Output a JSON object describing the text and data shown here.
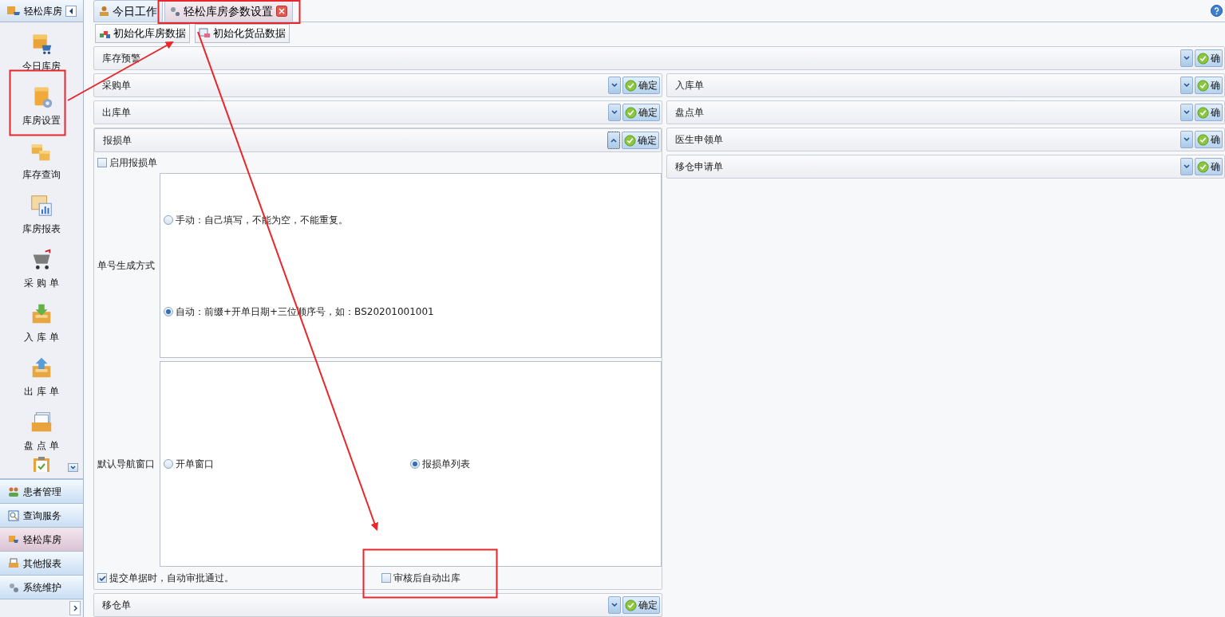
{
  "sidebar": {
    "title": "轻松库房",
    "items": [
      {
        "label": "今日库房"
      },
      {
        "label": "库房设置"
      },
      {
        "label": "库存查询"
      },
      {
        "label": "库房报表"
      },
      {
        "label": "采 购 单"
      },
      {
        "label": "入 库 单"
      },
      {
        "label": "出 库 单"
      },
      {
        "label": "盘 点 单"
      }
    ],
    "groups": [
      {
        "label": "患者管理",
        "selected": false
      },
      {
        "label": "查询服务",
        "selected": false
      },
      {
        "label": "轻松库房",
        "selected": true
      },
      {
        "label": "其他报表",
        "selected": false
      },
      {
        "label": "系统维护",
        "selected": false
      }
    ]
  },
  "tabs": [
    {
      "label": "今日工作",
      "selected": false,
      "closable": false
    },
    {
      "label": "轻松库房参数设置",
      "selected": true,
      "closable": true
    }
  ],
  "toolbar": [
    "初始化库房数据",
    "初始化货品数据"
  ],
  "top_panel": {
    "title": "库存预警",
    "expanded": false,
    "confirm": "确"
  },
  "left_panels": [
    {
      "title": "采购单",
      "expanded": false,
      "confirm": "确定"
    },
    {
      "title": "出库单",
      "expanded": false,
      "confirm": "确定"
    },
    {
      "title": "报损单",
      "expanded": true,
      "confirm": "确定",
      "body": {
        "enable": {
          "label": "启用报损单",
          "checked": false
        },
        "rows": [
          {
            "label": "单号生成方式",
            "kind": "stacked",
            "options": [
              {
                "label": "手动：自己填写，不能为空，不能重复。",
                "selected": false
              },
              {
                "label": "自动：前缀+开单日期+三位顺序号，如：BS20201001001",
                "selected": true
              }
            ]
          },
          {
            "label": "默认导航窗口",
            "kind": "inline",
            "options": [
              {
                "label": "开单窗口",
                "selected": false
              },
              {
                "label": "报损单列表",
                "selected": true
              }
            ]
          }
        ],
        "checks": [
          {
            "label": "提交单据时，自动审批通过。",
            "checked": true
          },
          {
            "label": "审核后自动出库",
            "checked": false
          }
        ]
      }
    },
    {
      "title": "移仓单",
      "expanded": false,
      "confirm": "确定"
    }
  ],
  "right_panels": [
    {
      "title": "入库单",
      "expanded": false,
      "confirm": "确"
    },
    {
      "title": "盘点单",
      "expanded": false,
      "confirm": "确"
    },
    {
      "title": "医生申领单",
      "expanded": false,
      "confirm": "确"
    },
    {
      "title": "移仓申请单",
      "expanded": false,
      "confirm": "确"
    }
  ]
}
